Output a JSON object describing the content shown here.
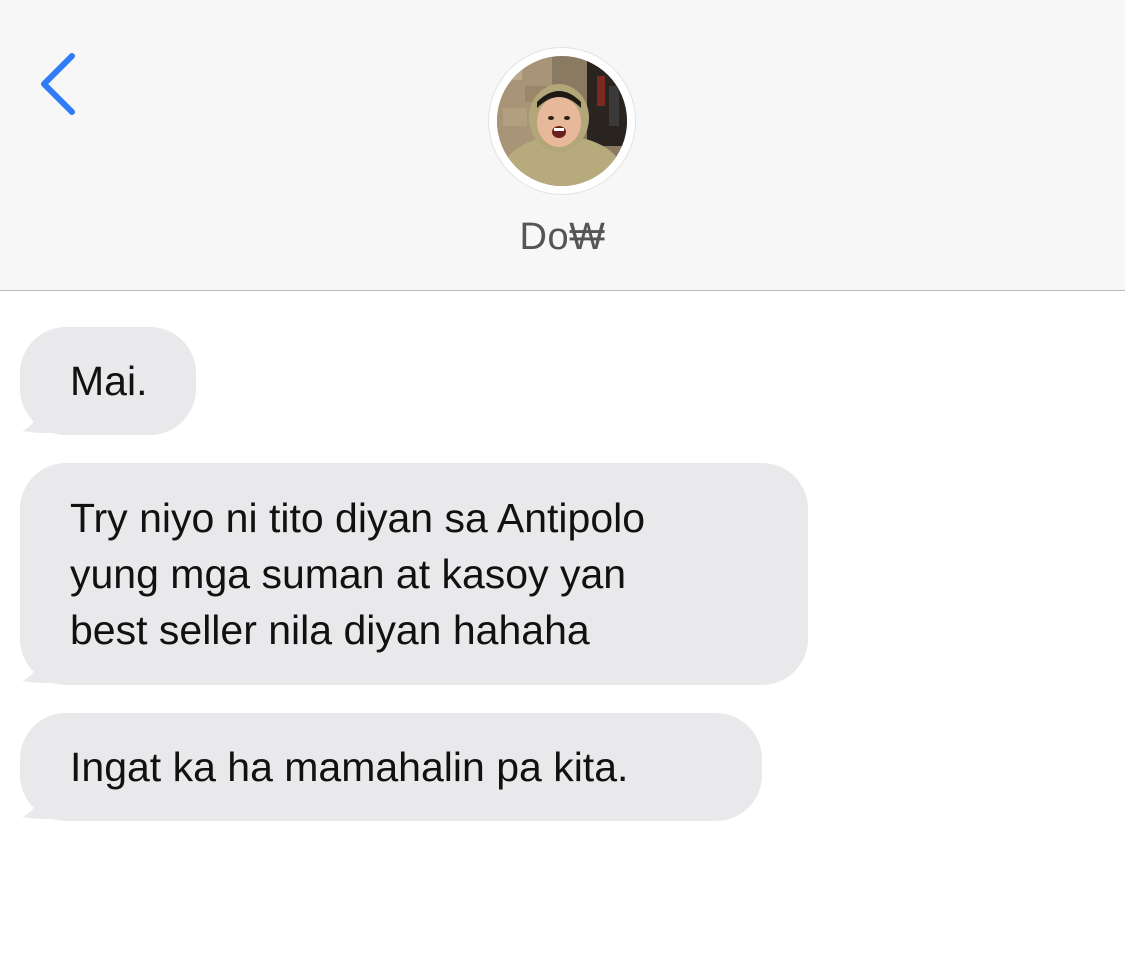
{
  "header": {
    "back_icon": "chevron-left-icon",
    "contact_name": "Do₩",
    "avatar_alt": "contact-photo"
  },
  "colors": {
    "header_bg": "#f7f7f7",
    "accent_blue": "#2f7cf6",
    "incoming_bubble": "#e9e9eb",
    "text": "#111111",
    "name_text": "#555555"
  },
  "messages": [
    {
      "direction": "incoming",
      "lines": [
        "Mai."
      ]
    },
    {
      "direction": "incoming",
      "lines": [
        "Try niyo ni tito diyan sa Antipolo",
        "yung mga suman at kasoy yan",
        "best seller nila diyan hahaha"
      ]
    },
    {
      "direction": "incoming",
      "lines": [
        "Ingat ka ha mamahalin pa kita."
      ]
    }
  ]
}
